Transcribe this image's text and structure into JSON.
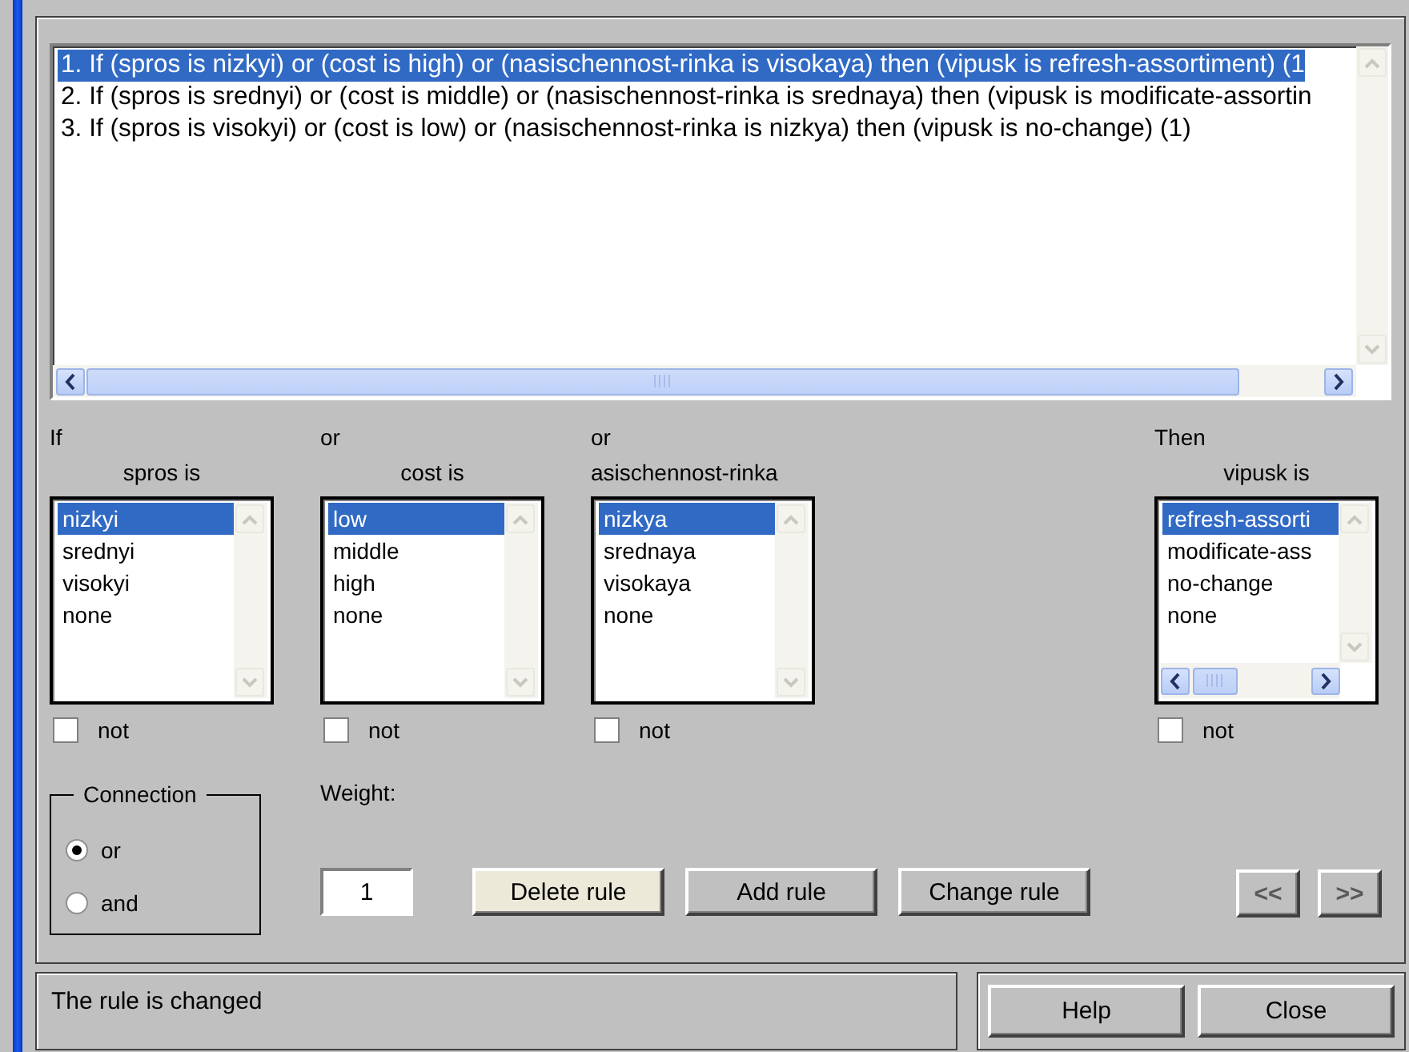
{
  "rules": [
    {
      "text": "1. If (spros is nizkyi) or (cost is high) or (nasischennost-rinka is visokaya) then (vipusk is refresh-assortiment) (1",
      "selected": true
    },
    {
      "text": "2. If (spros is srednyi) or (cost is middle) or (nasischennost-rinka is srednaya) then (vipusk is modificate-assortin",
      "selected": false
    },
    {
      "text": "3. If (spros is visokyi) or (cost is low) or (nasischennost-rinka is nizkya) then (vipusk is no-change) (1)",
      "selected": false
    }
  ],
  "columns": [
    {
      "kind": "condition",
      "connector": "If",
      "heading": "spros is",
      "items": [
        {
          "label": "nizkyi",
          "selected": true
        },
        {
          "label": "srednyi",
          "selected": false
        },
        {
          "label": "visokyi",
          "selected": false
        },
        {
          "label": "none",
          "selected": false
        }
      ],
      "not_label": "not",
      "not_checked": false
    },
    {
      "kind": "condition",
      "connector": "or",
      "heading": "cost is",
      "items": [
        {
          "label": "low",
          "selected": true
        },
        {
          "label": "middle",
          "selected": false
        },
        {
          "label": "high",
          "selected": false
        },
        {
          "label": "none",
          "selected": false
        }
      ],
      "not_label": "not",
      "not_checked": false
    },
    {
      "kind": "condition",
      "connector": "or",
      "heading": "asischennost-rinka",
      "items": [
        {
          "label": "nizkya",
          "selected": true
        },
        {
          "label": "srednaya",
          "selected": false
        },
        {
          "label": "visokaya",
          "selected": false
        },
        {
          "label": "none",
          "selected": false
        }
      ],
      "not_label": "not",
      "not_checked": false
    },
    {
      "kind": "conclusion",
      "connector": "Then",
      "heading": "vipusk is",
      "items": [
        {
          "label": "refresh-assorti",
          "selected": true
        },
        {
          "label": "modificate-ass",
          "selected": false
        },
        {
          "label": "no-change",
          "selected": false
        },
        {
          "label": "none",
          "selected": false
        }
      ],
      "not_label": "not",
      "not_checked": false
    }
  ],
  "connection": {
    "title": "Connection",
    "options": [
      {
        "label": "or",
        "selected": true
      },
      {
        "label": "and",
        "selected": false
      }
    ]
  },
  "weight": {
    "label": "Weight:",
    "value": "1"
  },
  "actions": [
    {
      "label": "Delete rule",
      "hovered": true,
      "disabled": false
    },
    {
      "label": "Add rule",
      "hovered": false,
      "disabled": false
    },
    {
      "label": "Change rule",
      "hovered": false,
      "disabled": false
    }
  ],
  "nav": [
    {
      "label": "<<",
      "disabled": true
    },
    {
      "label": ">>",
      "disabled": true
    }
  ],
  "status": "The rule is changed",
  "buttons": [
    {
      "label": "Help"
    },
    {
      "label": "Close"
    }
  ]
}
